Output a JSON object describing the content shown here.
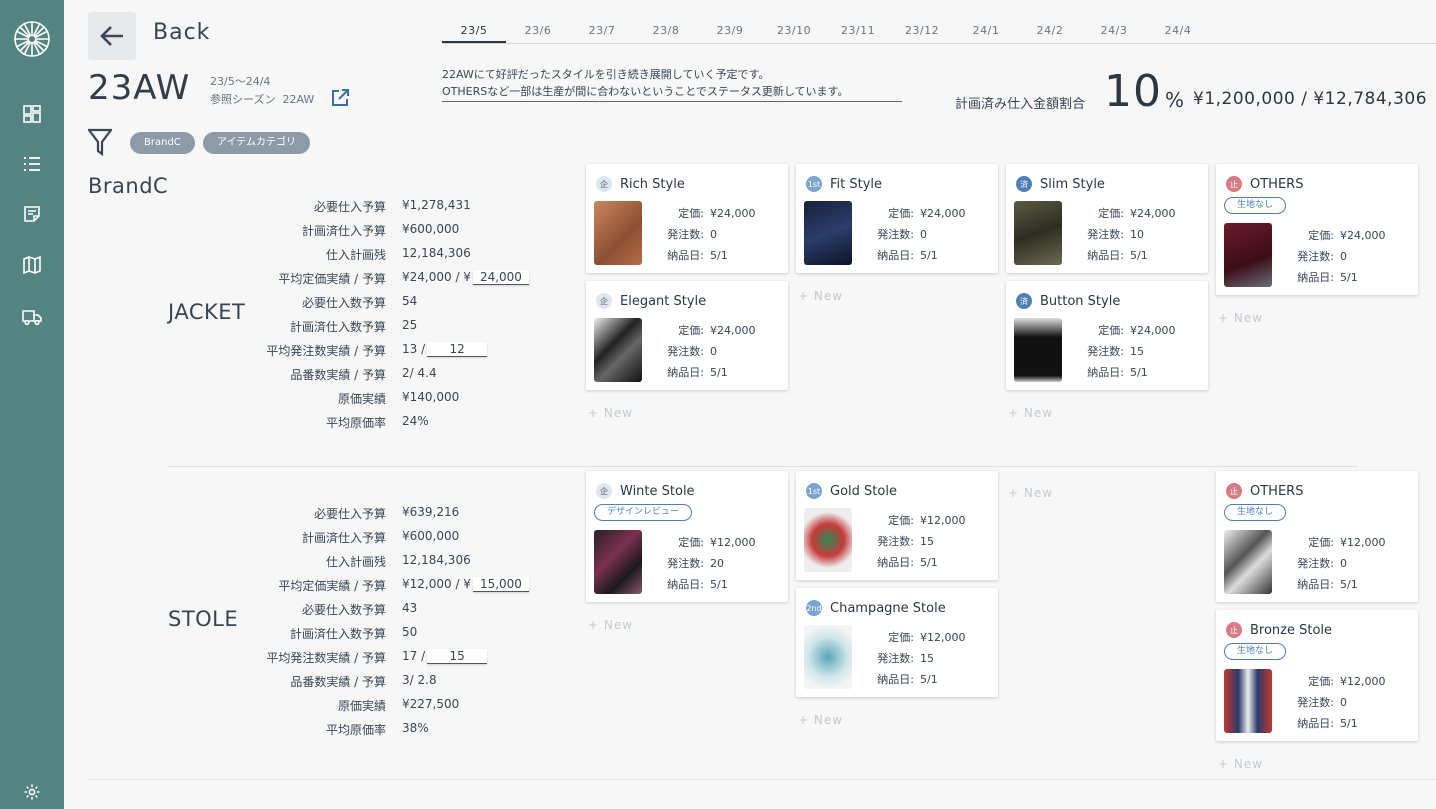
{
  "nav": {
    "back_label": "Back",
    "season": "23AW",
    "period": "23/5〜24/4",
    "ref_label": "参照シーズン",
    "ref_season": "22AW",
    "months": [
      "23/5",
      "23/6",
      "23/7",
      "23/8",
      "23/9",
      "23/10",
      "23/11",
      "23/12",
      "24/1",
      "24/2",
      "24/3",
      "24/4"
    ],
    "active_month": "23/5"
  },
  "memo": {
    "line1": "22AWにて好評だったスタイルを引き続き展開していく予定です。",
    "line2": "OTHERSなど一部は生産が間に合わないということでステータス更新しています。"
  },
  "summary": {
    "label": "計画済み仕入金額割合",
    "ratio": "10",
    "unit": "%",
    "amounts": "¥1,200,000 / ¥12,784,306"
  },
  "filters": {
    "chip1": "BrandC",
    "chip2": "アイテムカテゴリ"
  },
  "brand": "BrandC",
  "new_label": "+ New",
  "field_labels": {
    "price": "定価:",
    "orders": "発注数:",
    "delivery": "納品日:"
  },
  "categories": [
    {
      "name": "JACKET",
      "stats": [
        {
          "label": "必要仕入予算",
          "value": "¥1,278,431"
        },
        {
          "label": "計画済仕入予算",
          "value": "¥600,000"
        },
        {
          "label": "仕入計画残",
          "value": "12,184,306"
        },
        {
          "label": "平均定価実績 / 予算",
          "value": "¥24,000 / ¥",
          "input": "24,000"
        },
        {
          "label": "必要仕入数予算",
          "value": "54"
        },
        {
          "label": "計画済仕入数予算",
          "value": "25"
        },
        {
          "label": "平均発注数実績 / 予算",
          "value": "13 /",
          "input": "12"
        },
        {
          "label": "品番数実績 / 予算",
          "value": "2/ 4.4"
        },
        {
          "label": "原価実績",
          "value": "¥140,000"
        },
        {
          "label": "平均原価率",
          "value": "24%"
        }
      ],
      "cards": [
        {
          "badge": "企",
          "name": "Rich Style",
          "price": "¥24,000",
          "orders": "0",
          "delivery": "5/1"
        },
        {
          "badge": "企",
          "name": "Elegant Style",
          "price": "¥24,000",
          "orders": "0",
          "delivery": "5/1"
        },
        {
          "badge": "1st",
          "name": "Fit Style",
          "price": "¥24,000",
          "orders": "0",
          "delivery": "5/1"
        },
        {
          "badge": "済",
          "name": "Slim Style",
          "price": "¥24,000",
          "orders": "10",
          "delivery": "5/1"
        },
        {
          "badge": "済",
          "name": "Button Style",
          "price": "¥24,000",
          "orders": "15",
          "delivery": "5/1"
        },
        {
          "badge": "止",
          "name": "OTHERS",
          "tag": "生地なし",
          "price": "¥24,000",
          "orders": "0",
          "delivery": "5/1"
        }
      ]
    },
    {
      "name": "STOLE",
      "stats": [
        {
          "label": "必要仕入予算",
          "value": "¥639,216"
        },
        {
          "label": "計画済仕入予算",
          "value": "¥600,000"
        },
        {
          "label": "仕入計画残",
          "value": "12,184,306"
        },
        {
          "label": "平均定価実績 / 予算",
          "value": "¥12,000 / ¥",
          "input": "15,000"
        },
        {
          "label": "必要仕入数予算",
          "value": "43"
        },
        {
          "label": "計画済仕入数予算",
          "value": "50"
        },
        {
          "label": "平均発注数実績 / 予算",
          "value": "17 /",
          "input": "15"
        },
        {
          "label": "品番数実績 / 予算",
          "value": "3/ 2.8"
        },
        {
          "label": "原価実績",
          "value": "¥227,500"
        },
        {
          "label": "平均原価率",
          "value": "38%"
        }
      ],
      "cards": [
        {
          "badge": "企",
          "name": "Winte Stole",
          "tag": "デザインレビュー",
          "price": "¥12,000",
          "orders": "20",
          "delivery": "5/1"
        },
        {
          "badge": "1st",
          "name": "Gold Stole",
          "price": "¥12,000",
          "orders": "15",
          "delivery": "5/1"
        },
        {
          "badge": "2nd",
          "name": "Champagne Stole",
          "price": "¥12,000",
          "orders": "15",
          "delivery": "5/1"
        },
        {
          "badge": "止",
          "name": "OTHERS",
          "tag": "生地なし",
          "price": "¥12,000",
          "orders": "0",
          "delivery": "5/1"
        },
        {
          "badge": "止",
          "name": "Bronze Stole",
          "tag": "生地なし",
          "price": "¥12,000",
          "orders": "0",
          "delivery": "5/1"
        }
      ]
    }
  ]
}
